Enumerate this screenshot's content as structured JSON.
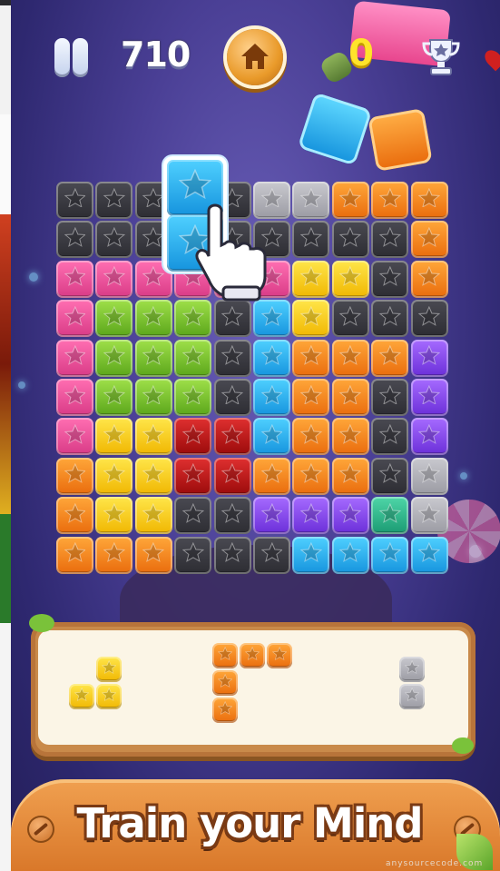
{
  "hud": {
    "score": "710",
    "coins": "0",
    "pause_icon": "pause-icon",
    "home_icon": "home-icon",
    "trophy_icon": "trophy-icon"
  },
  "colors": {
    "K": [
      "#4a4a52",
      "#2c2c32"
    ],
    "G": [
      "#c9c9cf",
      "#9a9aa2"
    ],
    "O": [
      "#ffa73a",
      "#e96b0c"
    ],
    "P": [
      "#ff6fb2",
      "#d83a86"
    ],
    "Y": [
      "#ffe64a",
      "#f0b600"
    ],
    "L": [
      "#9fe04a",
      "#5aa51a"
    ],
    "B": [
      "#4fd0ff",
      "#1593dd"
    ],
    "R": [
      "#e03030",
      "#9a0a0a"
    ],
    "V": [
      "#a66bff",
      "#6a2ed8"
    ],
    "T": [
      "#4fd6a8",
      "#1a9a72"
    ]
  },
  "board": {
    "rows": [
      "KKKKKGGOOO",
      "KKKKKKKKKO",
      "PPPPPPYYKO",
      "PLLLKBYKKK",
      "PLLLKBOOOV",
      "PLLLKBOOKV",
      "PYYRRBOOKV",
      "OYYRROOOKG",
      "OYYKKVVVTG",
      "OOOKKKBBBB"
    ]
  },
  "dragging_piece": {
    "color": "B",
    "cells": 2
  },
  "tray_pieces": [
    {
      "color": "Y",
      "shape": "small-corner"
    },
    {
      "color": "O",
      "shape": "L-shape"
    },
    {
      "color": "G",
      "shape": "vertical-pair"
    }
  ],
  "banner": {
    "text": "Train your Mind",
    "watermark": "anysourcecode.com"
  }
}
